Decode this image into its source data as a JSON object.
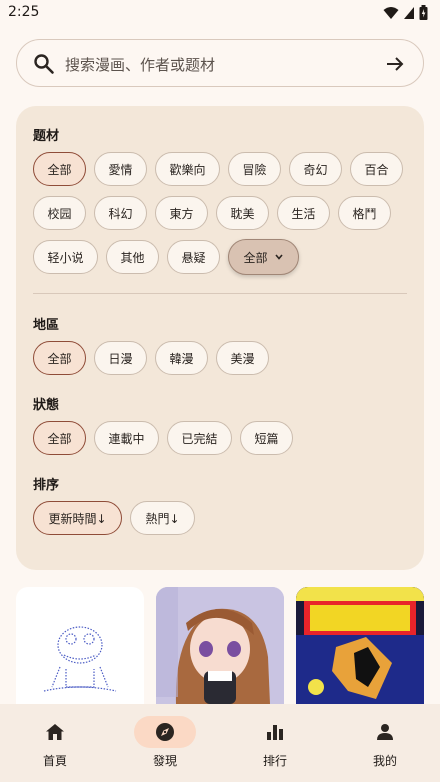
{
  "status": {
    "time": "2:25"
  },
  "search": {
    "placeholder": "搜索漫画、作者或题材"
  },
  "filters": {
    "genre": {
      "title": "题材",
      "chips": [
        "全部",
        "愛情",
        "歡樂向",
        "冒險",
        "奇幻",
        "百合",
        "校园",
        "科幻",
        "東方",
        "耽美",
        "生活",
        "格鬥",
        "轻小说",
        "其他",
        "悬疑"
      ],
      "dropdown_label": "全部"
    },
    "region": {
      "title": "地區",
      "chips": [
        "全部",
        "日漫",
        "韓漫",
        "美漫"
      ]
    },
    "state": {
      "title": "狀態",
      "chips": [
        "全部",
        "連載中",
        "已完結",
        "短篇"
      ]
    },
    "sort": {
      "title": "排序",
      "chips": [
        "更新時間↓",
        "熱門↓"
      ]
    }
  },
  "nav": {
    "items": [
      {
        "label": "首頁",
        "icon": "home-icon"
      },
      {
        "label": "發現",
        "icon": "compass-icon"
      },
      {
        "label": "排行",
        "icon": "bar-chart-icon"
      },
      {
        "label": "我的",
        "icon": "person-icon"
      }
    ],
    "active": "發現"
  },
  "colors": {
    "accent": "#8f4c38",
    "panel": "#f3e7d9",
    "background": "#fdf7f2",
    "active_nav": "#fbd9c5"
  }
}
